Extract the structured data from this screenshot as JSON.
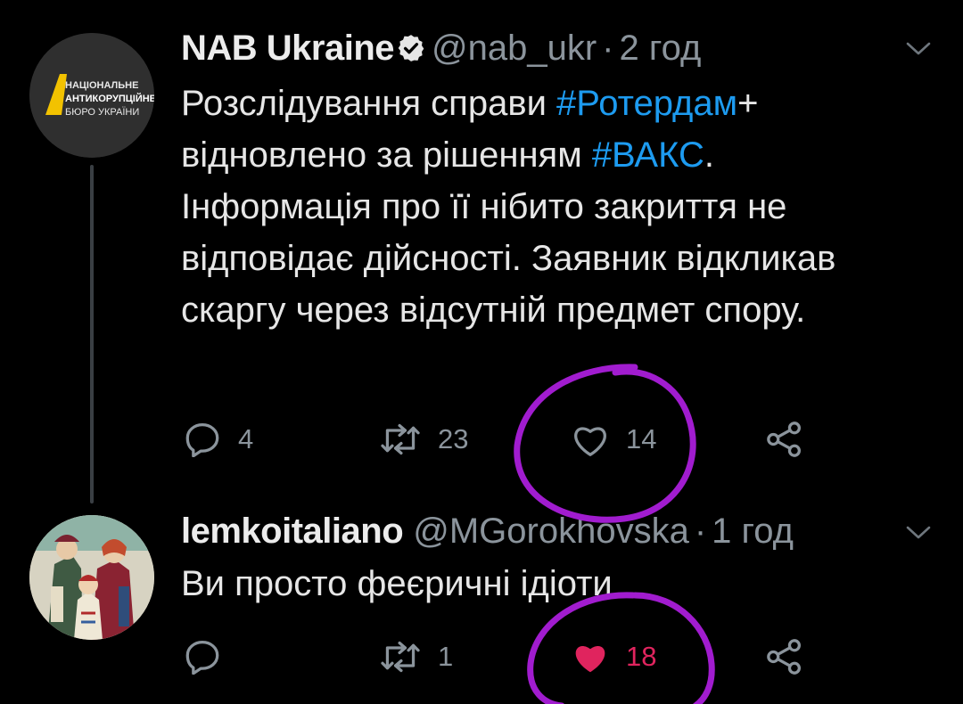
{
  "tweets": [
    {
      "author_name": "NAB Ukraine",
      "handle": "@nab_ukr",
      "time_sep": "·",
      "time": "2 год",
      "verified": true,
      "avatar": {
        "icon": "nabu-logo",
        "lines": [
          "НАЦІОНАЛЬНЕ",
          "АНТИКОРУПЦІЙНЕ",
          "БЮРО УКРАЇНИ"
        ],
        "accent": "#f2c200"
      },
      "text": {
        "p1": "Розслідування справи ",
        "tag1": "#Ротердам",
        "p2": "+ відновлено за рішенням ",
        "tag2": "#ВАКС",
        "p3": ". Інформація про її нібито закриття не відповідає дійсності. Заявник відкликав скаргу через відсутній предмет спору."
      },
      "actions": {
        "replies": "4",
        "retweets": "23",
        "likes": "14",
        "liked": false
      }
    },
    {
      "author_name": "lemkoitaliano",
      "handle": "@MGorokhovska",
      "time_sep": "·",
      "time": "1 год",
      "verified": false,
      "avatar": {
        "icon": "folk-painting-avatar"
      },
      "text": {
        "p1": "Ви просто феєричні ідіоти"
      },
      "actions": {
        "replies": "",
        "retweets": "1",
        "likes": "18",
        "liked": true
      }
    }
  ],
  "colors": {
    "background": "#000000",
    "hashtag": "#1d9bf0",
    "liked": "#e0245e",
    "muted": "#8b949c",
    "annotation": "#a11ccf"
  }
}
